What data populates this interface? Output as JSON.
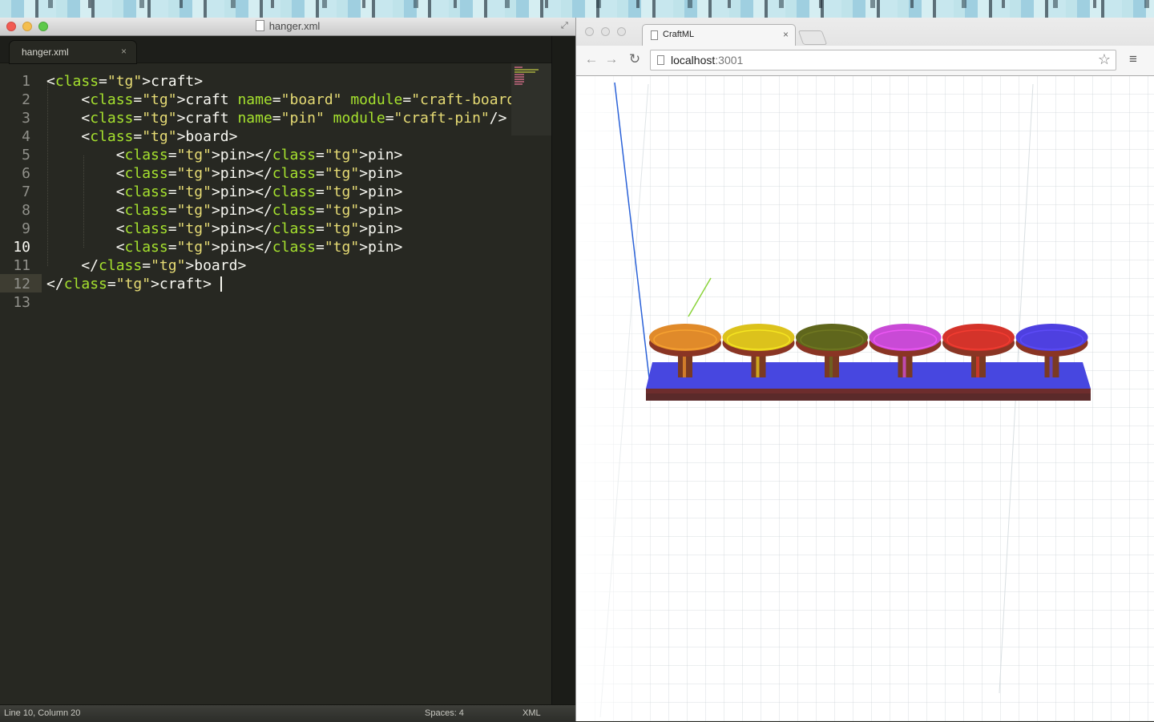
{
  "editor": {
    "window_title": "hanger.xml",
    "tab_label": "hanger.xml",
    "tab_close": "×",
    "line_numbers": [
      "1",
      "2",
      "3",
      "4",
      "5",
      "6",
      "7",
      "8",
      "9",
      "10",
      "11",
      "12",
      "13"
    ],
    "code_lines": [
      "<craft>",
      "    <craft name=\"board\" module=\"craft-board\"/>",
      "    <craft name=\"pin\" module=\"craft-pin\"/>",
      "    <board>",
      "        <pin></pin>",
      "        <pin></pin>",
      "        <pin></pin>",
      "        <pin></pin>",
      "        <pin></pin>",
      "        <pin></pin>",
      "    </board>",
      "</craft>",
      ""
    ],
    "active_line": "10",
    "status": {
      "position": "Line 10, Column 20",
      "spaces": "Spaces: 4",
      "syntax": "XML"
    },
    "colors": {
      "background": "#272822",
      "tag": "#f92672",
      "attribute": "#a6e22e",
      "string": "#e6db74",
      "text": "#f8f8f2"
    }
  },
  "browser": {
    "tab_title": "CraftML",
    "tab_close": "×",
    "url_host": "localhost",
    "url_port": ":3001",
    "icons": {
      "back": "back-arrow-icon",
      "forward": "forward-arrow-icon",
      "reload": "reload-icon",
      "star": "star-icon",
      "menu": "hamburger-menu-icon"
    }
  },
  "scene": {
    "board_color": "#4747e0",
    "pin_colors": [
      "#e08a2a",
      "#dcc21c",
      "#5f661c",
      "#c94ad6",
      "#d4332a",
      "#4e40e0"
    ]
  }
}
